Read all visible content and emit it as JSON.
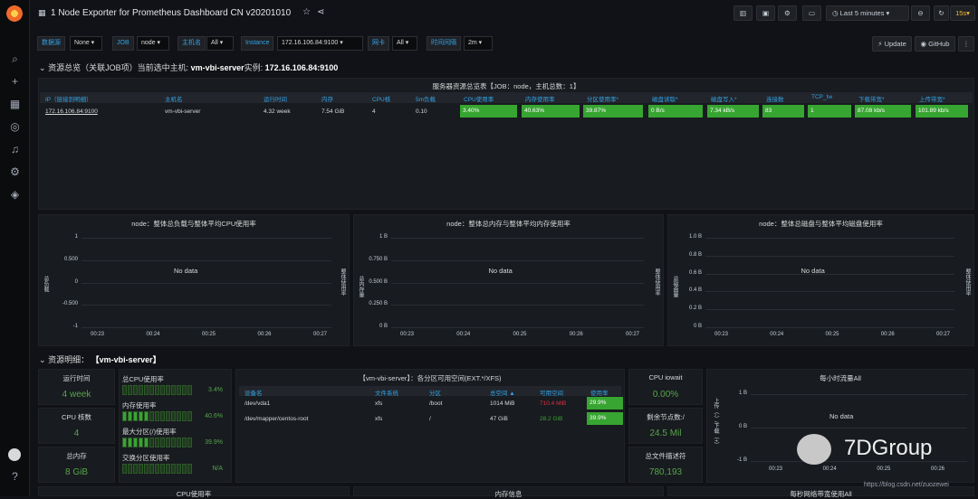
{
  "app": {
    "title": "1 Node Exporter for Prometheus Dashboard CN v20201010"
  },
  "toolbar": {
    "time_range": "Last 5 minutes",
    "refresh": "15s"
  },
  "vars": [
    {
      "label": "数据源",
      "value": "None"
    },
    {
      "label": "JOB",
      "value": "node"
    },
    {
      "label": "主机名",
      "value": "All"
    },
    {
      "label": "Instance",
      "value": "172.16.106.84:9100"
    },
    {
      "label": "网卡",
      "value": "All"
    },
    {
      "label": "时间间隔",
      "value": "2m"
    }
  ],
  "links": {
    "update": "Update",
    "github": "GitHub"
  },
  "row1": {
    "title": "资源总览（关联JOB项）当前选中主机:",
    "host": "vm-vbi-server",
    "inst_label": "实例:",
    "inst": "172.16.106.84:9100"
  },
  "overview": {
    "title": "服务器资源总览表【JOB：node，主机总数：1】",
    "headers": [
      "IP（链接到明细）",
      "主机名",
      "运行时间",
      "内存",
      "CPU核",
      "5m负载",
      "CPU使用率",
      "内存使用率",
      "分区使用率*",
      "磁盘读取*",
      "磁盘写入*",
      "连接数",
      "TCP_tw",
      "下载带宽*",
      "上传带宽*"
    ],
    "row": [
      "172.16.106.84:9100",
      "vm-vbi-server",
      "4.32 week",
      "7.54 GiB",
      "4",
      "0.10",
      "3.40%",
      "40.63%",
      "39.87%",
      "0 B/s",
      "7.34 kB/s",
      "83",
      "1",
      "87.08 kb/s",
      "101.89 kb/s"
    ]
  },
  "graphs": [
    {
      "title": "node：整体总负载与整体平均CPU使用率",
      "nodata": "No data",
      "yticks": [
        "1",
        "0.500",
        "0",
        "-0.500",
        "-1"
      ],
      "xticks": [
        "00:23",
        "00:24",
        "00:25",
        "00:26",
        "00:27"
      ],
      "ylabel": "总负载",
      "y2label": "整体使用率"
    },
    {
      "title": "node：整体总内存与整体平均内存使用率",
      "nodata": "No data",
      "yticks": [
        "1 B",
        "0.750 B",
        "0.500 B",
        "0.250 B",
        "0 B"
      ],
      "xticks": [
        "00:23",
        "00:24",
        "00:25",
        "00:26",
        "00:27"
      ],
      "ylabel": "总内存量",
      "y2label": "整体使用率"
    },
    {
      "title": "node：整体总磁盘与整体平均磁盘使用率",
      "nodata": "No data",
      "yticks": [
        "1.0 B",
        "0.8 B",
        "0.6 B",
        "0.4 B",
        "0.2 B",
        "0 B"
      ],
      "xticks": [
        "00:23",
        "00:24",
        "00:25",
        "00:26",
        "00:27"
      ],
      "ylabel": "总磁盘量",
      "y2label": "整体使用率"
    }
  ],
  "row2": {
    "title": "资源明细：",
    "host": "【vm-vbi-server】"
  },
  "stats": [
    {
      "label": "运行时间",
      "value": "4 week"
    },
    {
      "label": "CPU 核数",
      "value": "4"
    },
    {
      "label": "总内存",
      "value": "8 GiB"
    }
  ],
  "gauges": [
    {
      "label": "总CPU使用率",
      "value": "3.4%",
      "fraction": 0.034
    },
    {
      "label": "内存使用率",
      "value": "40.6%",
      "fraction": 0.406
    },
    {
      "label": "最大分区(/)使用率",
      "value": "39.9%",
      "fraction": 0.399
    },
    {
      "label": "交换分区使用率",
      "value": "N/A",
      "fraction": 0
    }
  ],
  "partitions": {
    "title": "【vm-vbi-server】：各分区可用空间(EXT.*/XFS)",
    "headers": [
      "设备名",
      "文件系统",
      "分区",
      "总空间 ▲",
      "可用空间",
      "使用率"
    ],
    "rows": [
      [
        "/dev/vda1",
        "xfs",
        "/boot",
        "1014 MiB",
        "710.4 MiB",
        "29.9%"
      ],
      [
        "/dev/mapper/centos-root",
        "xfs",
        "/",
        "47 GiB",
        "28.2 GiB",
        "39.9%"
      ]
    ]
  },
  "iowait": {
    "label": "CPU iowait",
    "value": "0.00%"
  },
  "inodes": {
    "label": "剩余节点数:/",
    "value": "24.5 Mil"
  },
  "fds": {
    "label": "总文件描述符",
    "value": "780,193"
  },
  "traffic": {
    "title": "每小时流量All",
    "nodata": "No data",
    "yticks": [
      "1 B",
      "0 B",
      "-1 B"
    ],
    "xticks": [
      "00:23",
      "00:24",
      "00:25",
      "00:26"
    ],
    "ylabel": "上传（-）/下载（+）"
  },
  "bottom": {
    "cpu": "CPU使用率",
    "mem": "内存信息",
    "net": "每秒网络带宽使用All"
  },
  "watermark": {
    "brand": "7DGroup",
    "url": "https://blog.csdn.net/zuozewei"
  },
  "colors": {
    "green": "#37a531",
    "blue": "#33a2e5",
    "red": "#e02f44",
    "bg": "#111217",
    "panel": "#181b1f"
  }
}
